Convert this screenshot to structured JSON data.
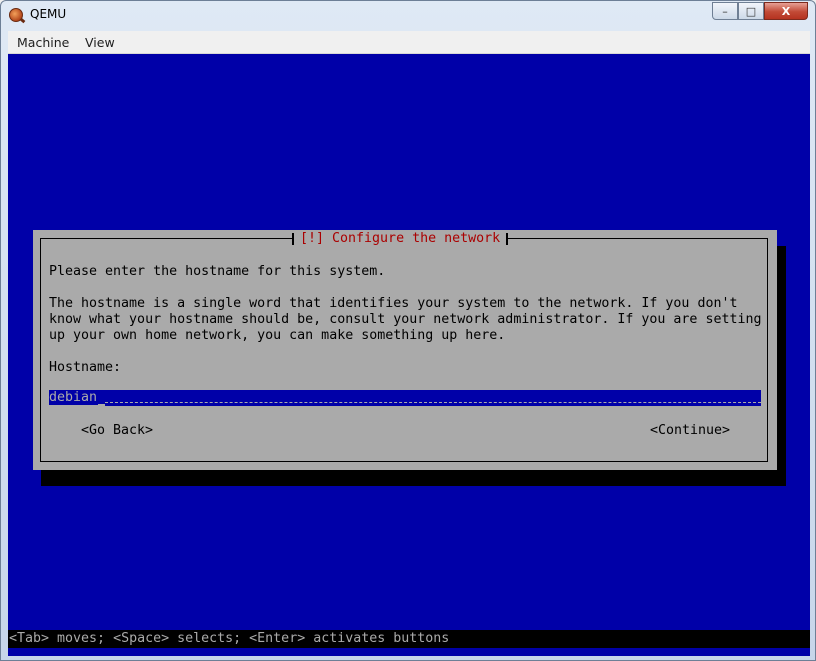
{
  "window": {
    "title": "QEMU",
    "controls": {
      "minimize": "–",
      "maximize": "□",
      "close": "X"
    }
  },
  "menubar": {
    "items": [
      {
        "label": "Machine"
      },
      {
        "label": "View"
      }
    ]
  },
  "installer": {
    "dialog_title": "[!] Configure the network",
    "prompt": "Please enter the hostname for this system.",
    "description_lines": [
      "The hostname is a single word that identifies your system to the network. If you don't",
      "know what your hostname should be, consult your network administrator. If you are setting",
      "up your own home network, you can make something up here."
    ],
    "field_label": "Hostname:",
    "hostname_value": "debian",
    "buttons": {
      "back": "<Go Back>",
      "continue": "<Continue>"
    },
    "help_text": "<Tab> moves; <Space> selects; <Enter> activates buttons"
  },
  "colors": {
    "screen_background": "#0000a8",
    "dialog_background": "#aaaaaa",
    "dialog_title_color": "#aa0000",
    "help_bar_background": "#000000"
  },
  "icons": {
    "app_icon": "qemu-icon"
  }
}
